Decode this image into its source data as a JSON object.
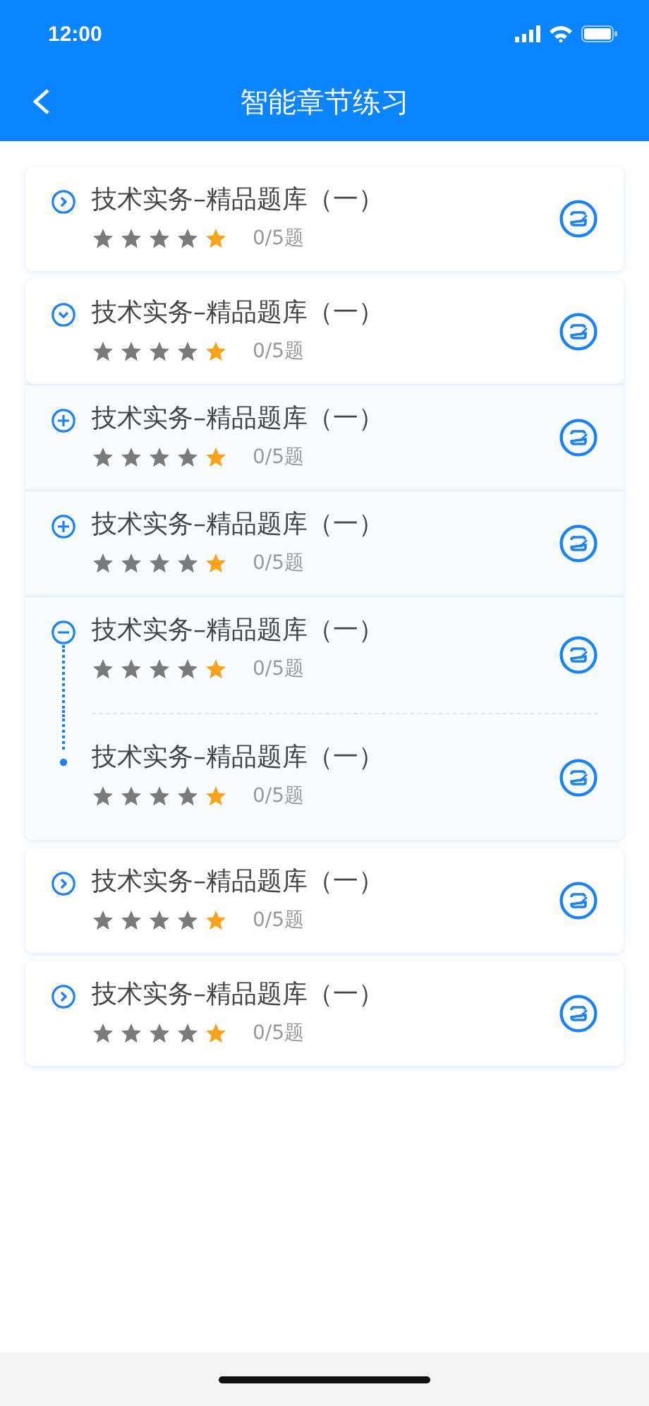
{
  "status_bar": {
    "time": "12:00"
  },
  "nav": {
    "title": "智能章节练习"
  },
  "chapters": [
    {
      "title": "技术实务–精品题库（一）",
      "stars": 1,
      "progress": "0/5题",
      "expanded": false
    },
    {
      "title": "技术实务–精品题库（一）",
      "stars": 1,
      "progress": "0/5题",
      "expanded": true,
      "children": [
        {
          "title": "技术实务–精品题库（一）",
          "stars": 1,
          "progress": "0/5题",
          "expanded": false
        },
        {
          "title": "技术实务–精品题库（一）",
          "stars": 1,
          "progress": "0/5题",
          "expanded": false
        },
        {
          "title": "技术实务–精品题库（一）",
          "stars": 1,
          "progress": "0/5题",
          "expanded": true,
          "children": [
            {
              "title": "技术实务–精品题库（一）",
              "stars": 1,
              "progress": "0/5题"
            }
          ]
        }
      ]
    },
    {
      "title": "技术实务–精品题库（一）",
      "stars": 1,
      "progress": "0/5题",
      "expanded": false
    },
    {
      "title": "技术实务–精品题库（一）",
      "stars": 1,
      "progress": "0/5题",
      "expanded": false
    }
  ]
}
